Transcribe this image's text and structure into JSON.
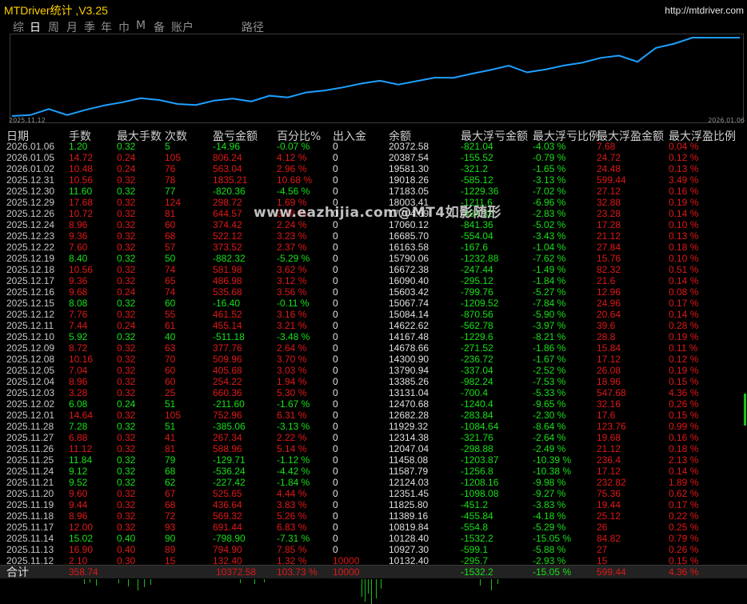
{
  "app": {
    "title": "MTDriver统计 ,V3.25",
    "url": "http://mtdriver.com",
    "watermark": "www.eazhijia.com@MT4如影随形"
  },
  "tabs": [
    {
      "label": "综",
      "active": false
    },
    {
      "label": "日",
      "active": true
    },
    {
      "label": "周",
      "active": false
    },
    {
      "label": "月",
      "active": false
    },
    {
      "label": "季",
      "active": false
    },
    {
      "label": "年",
      "active": false
    },
    {
      "label": "巾",
      "active": false
    },
    {
      "label": "M",
      "active": false
    },
    {
      "label": "备",
      "active": false
    },
    {
      "label": "账户",
      "active": false
    },
    {
      "label": "路径",
      "active": false
    }
  ],
  "equity_chart": {
    "start_label": "2025.11.12",
    "end_label": "2026.01.06",
    "line_color": "#1ea0ff"
  },
  "columns": [
    "日期",
    "手数",
    "最大手数",
    "次数",
    "盈亏金额",
    "百分比%",
    "出入金",
    "余额",
    "最大浮亏金额",
    "最大浮亏比例",
    "最大浮盈金额",
    "最大浮盈比例"
  ],
  "rows": [
    [
      "2026.01.06",
      "1.20",
      "0.32",
      "5",
      "-14.96",
      "-0.07 %",
      "0",
      "20372.58",
      "-821.04",
      "-4.03 %",
      "7.68",
      "0.04 %"
    ],
    [
      "2026.01.05",
      "14.72",
      "0.24",
      "105",
      "806.24",
      "4.12 %",
      "0",
      "20387.54",
      "-155.52",
      "-0.79 %",
      "24.72",
      "0.12 %"
    ],
    [
      "2026.01.02",
      "10.48",
      "0.24",
      "76",
      "563.04",
      "2.96 %",
      "0",
      "19581.30",
      "-321.2",
      "-1.65 %",
      "24.48",
      "0.13 %"
    ],
    [
      "2025.12.31",
      "10.56",
      "0.32",
      "78",
      "1835.21",
      "10.68 %",
      "0",
      "19018.26",
      "-585.12",
      "-3.13 %",
      "599.44",
      "3.49 %"
    ],
    [
      "2025.12.30",
      "11.60",
      "0.32",
      "77",
      "-820.36",
      "-4.56 %",
      "0",
      "17183.05",
      "-1229.36",
      "-7.02 %",
      "27.12",
      "0.16 %"
    ],
    [
      "2025.12.29",
      "17.68",
      "0.32",
      "124",
      "298.72",
      "1.69 %",
      "0",
      "18003.41",
      "-1211.6",
      "-6.96 %",
      "32.88",
      "0.19 %"
    ],
    [
      "2025.12.26",
      "10.72",
      "0.32",
      "81",
      "644.57",
      "3.78 %",
      "0",
      "17704.69",
      "-484.32",
      "-2.83 %",
      "23.28",
      "0.14 %"
    ],
    [
      "2025.12.24",
      "8.96",
      "0.32",
      "60",
      "374.42",
      "2.24 %",
      "0",
      "17060.12",
      "-841.36",
      "-5.02 %",
      "17.28",
      "0.10 %"
    ],
    [
      "2025.12.23",
      "9.36",
      "0.32",
      "68",
      "522.12",
      "3.23 %",
      "0",
      "16685.70",
      "-554.04",
      "-3.43 %",
      "21.12",
      "0.13 %"
    ],
    [
      "2025.12.22",
      "7.60",
      "0.32",
      "57",
      "373.52",
      "2.37 %",
      "0",
      "16163.58",
      "-167.6",
      "-1.04 %",
      "27.84",
      "0.18 %"
    ],
    [
      "2025.12.19",
      "8.40",
      "0.32",
      "50",
      "-882.32",
      "-5.29 %",
      "0",
      "15790.06",
      "-1232.88",
      "-7.62 %",
      "15.76",
      "0.10 %"
    ],
    [
      "2025.12.18",
      "10.56",
      "0.32",
      "74",
      "581.98",
      "3.62 %",
      "0",
      "16672.38",
      "-247.44",
      "-1.49 %",
      "82.32",
      "0.51 %"
    ],
    [
      "2025.12.17",
      "9.36",
      "0.32",
      "65",
      "486.98",
      "3.12 %",
      "0",
      "16090.40",
      "-295.12",
      "-1.84 %",
      "21.6",
      "0.14 %"
    ],
    [
      "2025.12.16",
      "9.68",
      "0.24",
      "74",
      "535.68",
      "3.56 %",
      "0",
      "15603.42",
      "-799.76",
      "-5.27 %",
      "12.96",
      "0.08 %"
    ],
    [
      "2025.12.15",
      "8.08",
      "0.32",
      "60",
      "-16.40",
      "-0.11 %",
      "0",
      "15067.74",
      "-1209.52",
      "-7.84 %",
      "24.96",
      "0.17 %"
    ],
    [
      "2025.12.12",
      "7.76",
      "0.32",
      "55",
      "461.52",
      "3.16 %",
      "0",
      "15084.14",
      "-870.56",
      "-5.90 %",
      "20.64",
      "0.14 %"
    ],
    [
      "2025.12.11",
      "7.44",
      "0.24",
      "61",
      "455.14",
      "3.21 %",
      "0",
      "14622.62",
      "-562.78",
      "-3.97 %",
      "39.6",
      "0.28 %"
    ],
    [
      "2025.12.10",
      "5.92",
      "0.32",
      "40",
      "-511.18",
      "-3.48 %",
      "0",
      "14167.48",
      "-1229.6",
      "-8.21 %",
      "28.8",
      "0.19 %"
    ],
    [
      "2025.12.09",
      "8.72",
      "0.32",
      "63",
      "377.76",
      "2.64 %",
      "0",
      "14678.66",
      "-271.52",
      "-1.86 %",
      "15.84",
      "0.11 %"
    ],
    [
      "2025.12.08",
      "10.16",
      "0.32",
      "70",
      "509.96",
      "3.70 %",
      "0",
      "14300.90",
      "-236.72",
      "-1.67 %",
      "17.12",
      "0.12 %"
    ],
    [
      "2025.12.05",
      "7.04",
      "0.32",
      "60",
      "405.68",
      "3.03 %",
      "0",
      "13790.94",
      "-337.04",
      "-2.52 %",
      "26.08",
      "0.19 %"
    ],
    [
      "2025.12.04",
      "8.96",
      "0.32",
      "60",
      "254.22",
      "1.94 %",
      "0",
      "13385.26",
      "-982.24",
      "-7.53 %",
      "18.96",
      "0.15 %"
    ],
    [
      "2025.12.03",
      "3.28",
      "0.32",
      "25",
      "660.36",
      "5.30 %",
      "0",
      "13131.04",
      "-700.4",
      "-5.33 %",
      "547.68",
      "4.36 %"
    ],
    [
      "2025.12.02",
      "6.08",
      "0.24",
      "51",
      "-211.60",
      "-1.67 %",
      "0",
      "12470.68",
      "-1240.4",
      "-9.65 %",
      "32.16",
      "0.26 %"
    ],
    [
      "2025.12.01",
      "14.64",
      "0.32",
      "105",
      "752.96",
      "6.31 %",
      "0",
      "12682.28",
      "-283.84",
      "-2.30 %",
      "17.6",
      "0.15 %"
    ],
    [
      "2025.11.28",
      "7.28",
      "0.32",
      "51",
      "-385.06",
      "-3.13 %",
      "0",
      "11929.32",
      "-1084.64",
      "-8.64 %",
      "123.76",
      "0.99 %"
    ],
    [
      "2025.11.27",
      "6.88",
      "0.32",
      "41",
      "267.34",
      "2.22 %",
      "0",
      "12314.38",
      "-321.76",
      "-2.64 %",
      "19.68",
      "0.16 %"
    ],
    [
      "2025.11.26",
      "11.12",
      "0.32",
      "81",
      "588.96",
      "5.14 %",
      "0",
      "12047.04",
      "-298.88",
      "-2.49 %",
      "21.12",
      "0.18 %"
    ],
    [
      "2025.11.25",
      "11.84",
      "0.32",
      "79",
      "-129.71",
      "-1.12 %",
      "0",
      "11458.08",
      "-1203.87",
      "-10.39 %",
      "236.4",
      "2.13 %"
    ],
    [
      "2025.11.24",
      "9.12",
      "0.32",
      "68",
      "-536.24",
      "-4.42 %",
      "0",
      "11587.79",
      "-1256.8",
      "-10.38 %",
      "17.12",
      "0.14 %"
    ],
    [
      "2025.11.21",
      "9.52",
      "0.32",
      "62",
      "-227.42",
      "-1.84 %",
      "0",
      "12124.03",
      "-1208.16",
      "-9.98 %",
      "232.82",
      "1.89 %"
    ],
    [
      "2025.11.20",
      "9.60",
      "0.32",
      "67",
      "525.65",
      "4.44 %",
      "0",
      "12351.45",
      "-1098.08",
      "-9.27 %",
      "75.36",
      "0.62 %"
    ],
    [
      "2025.11.19",
      "9.44",
      "0.32",
      "68",
      "436.64",
      "3.83 %",
      "0",
      "11825.80",
      "-451.2",
      "-3.83 %",
      "19.44",
      "0.17 %"
    ],
    [
      "2025.11.18",
      "8.96",
      "0.32",
      "72",
      "569.32",
      "5.26 %",
      "0",
      "11389.16",
      "-455.84",
      "-4.18 %",
      "25.12",
      "0.22 %"
    ],
    [
      "2025.11.17",
      "12.00",
      "0.32",
      "93",
      "691.44",
      "6.83 %",
      "0",
      "10819.84",
      "-554.8",
      "-5.29 %",
      "26",
      "0.25 %"
    ],
    [
      "2025.11.14",
      "15.02",
      "0.40",
      "90",
      "-798.90",
      "-7.31 %",
      "0",
      "10128.40",
      "-1532.2",
      "-15.05 %",
      "84.82",
      "0.79 %"
    ],
    [
      "2025.11.13",
      "16.90",
      "0.40",
      "89",
      "794.90",
      "7.85 %",
      "0",
      "10927.30",
      "-599.1",
      "-5.88 %",
      "27",
      "0.26 %"
    ],
    [
      "2025.11.12",
      "2.10",
      "0.30",
      "15",
      "132.40",
      "1.32 %",
      "10000",
      "10132.40",
      "-295.7",
      "-2.93 %",
      "15",
      "0.15 %"
    ]
  ],
  "total": {
    "label": "合计",
    "lots": "358.74",
    "pnl": "10372.58",
    "pct": "103.73 %",
    "deposit": "10000",
    "max_dd": "-1532.2",
    "max_dd_pct": "-15.05 %",
    "max_fp": "599.44",
    "max_fp_pct": "4.36 %"
  },
  "colors": {
    "title": "#ffd000",
    "profit": "#18e018",
    "loss": "#e01818",
    "neutral": "#e0e0e0",
    "equity_line": "#1ea0ff"
  }
}
